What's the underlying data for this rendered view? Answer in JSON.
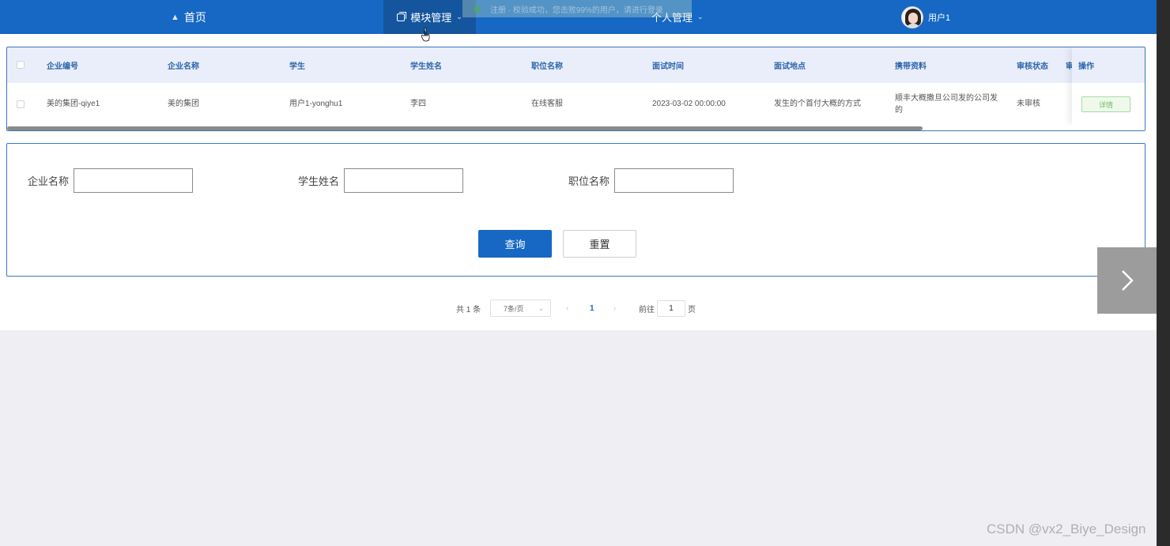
{
  "nav": {
    "home": "首页",
    "module": "模块管理",
    "personal": "个人管理",
    "user": "用户1",
    "toast": "注册 · 校验成功，您击败99%的用户，请进行登录"
  },
  "table": {
    "headers": [
      "企业编号",
      "企业名称",
      "学生",
      "学生姓名",
      "职位名称",
      "面试时间",
      "面试地点",
      "携带资料",
      "审核状态",
      "审",
      "操作"
    ],
    "rows": [
      {
        "company_no": "美的集团-qiye1",
        "company_name": "美的集团",
        "student": "用户1-yonghu1",
        "student_name": "李四",
        "position": "在线客服",
        "interview_time": "2023-03-02 00:00:00",
        "interview_place": "发生的个首付大概的方式",
        "materials": "顺丰大概撒旦公司发的公司发的",
        "review_status": "未审核",
        "action": "详情"
      }
    ]
  },
  "search": {
    "company_label": "企业名称",
    "student_label": "学生姓名",
    "position_label": "职位名称",
    "company_value": "",
    "student_value": "",
    "position_value": "",
    "query": "查询",
    "reset": "重置"
  },
  "pagination": {
    "total": "共 1 条",
    "page_size": "7条/页",
    "current": "1",
    "goto_prefix": "前往",
    "goto_value": "1",
    "goto_suffix": "页"
  },
  "watermark": "CSDN @vx2_Biye_Design"
}
